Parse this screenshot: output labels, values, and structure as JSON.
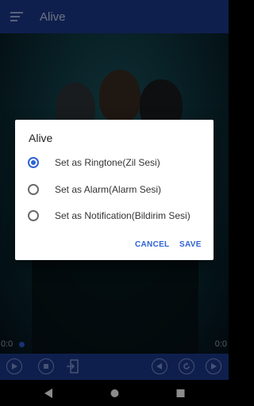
{
  "app": {
    "title": "Alive"
  },
  "player": {
    "time_elapsed": "0:0",
    "time_total": "0:0",
    "progress": 0.0
  },
  "dialog": {
    "title": "Alive",
    "options": [
      {
        "label": "Set as Ringtone(Zil Sesi)",
        "checked": true
      },
      {
        "label": "Set as Alarm(Alarm Sesi)",
        "checked": false
      },
      {
        "label": "Set as Notification(Bildirim Sesi)",
        "checked": false
      }
    ],
    "cancel_label": "CANCEL",
    "save_label": "SAVE"
  },
  "colors": {
    "primary": "#1c3a8c",
    "accent": "#2f63d6"
  },
  "icons": {
    "menu": "menu-icon",
    "play": "play-icon",
    "stop": "stop-icon",
    "exit": "exit-icon",
    "previous": "previous-icon",
    "repeat": "repeat-icon",
    "next": "next-icon",
    "back": "back-icon",
    "home": "home-icon",
    "recents": "recents-icon"
  }
}
